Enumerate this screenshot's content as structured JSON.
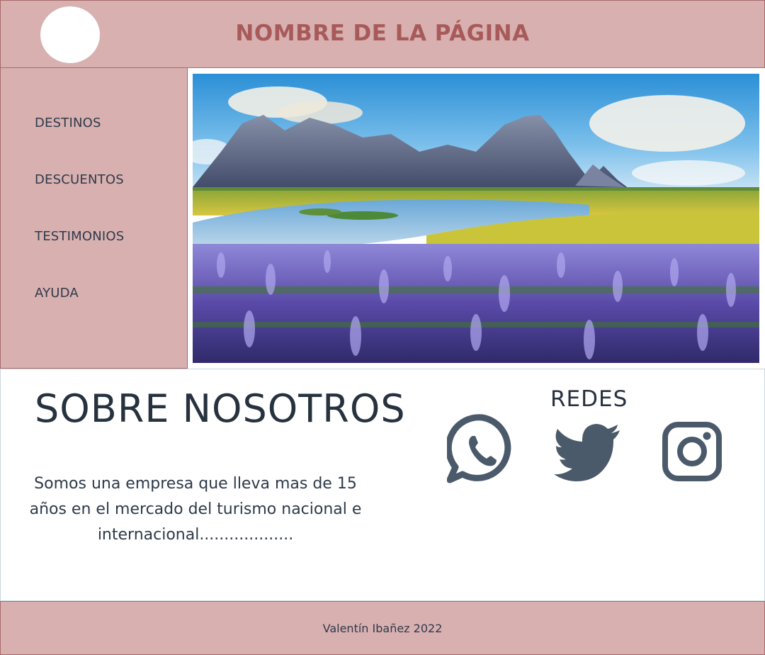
{
  "header": {
    "title": "NOMBRE DE LA PÁGINA"
  },
  "sidebar": {
    "items": [
      {
        "label": "DESTINOS"
      },
      {
        "label": "DESCUENTOS"
      },
      {
        "label": "TESTIMONIOS"
      },
      {
        "label": "AYUDA"
      }
    ]
  },
  "about": {
    "title": "SOBRE NOSOTROS",
    "text": "Somos una empresa que lleva mas de 15 años en el mercado del turismo nacional e internacional..................."
  },
  "social": {
    "title": "REDES",
    "icons": [
      "whatsapp-icon",
      "twitter-icon",
      "instagram-icon"
    ],
    "icon_color": "#4a5a6a"
  },
  "footer": {
    "text": "Valentín Ibañez 2022"
  },
  "colors": {
    "panel_bg": "#d8b0b0",
    "border": "#a86a6a",
    "title_accent": "#a85a5a"
  }
}
